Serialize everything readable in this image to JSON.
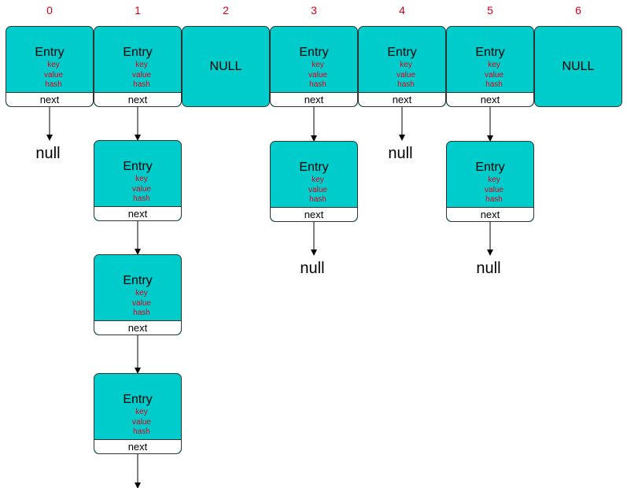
{
  "fill_color": "#00cccc",
  "index_color": "#d0021b",
  "entry_label": "Entry",
  "fields": [
    "key",
    "value",
    "hash"
  ],
  "next_label": "next",
  "null_slot_label": "NULL",
  "null_label": "null",
  "buckets": [
    {
      "index": "0",
      "slot": "entry",
      "chain_length": 0,
      "terminates_with": "null"
    },
    {
      "index": "1",
      "slot": "entry",
      "chain_length": 3,
      "terminates_with": "continues"
    },
    {
      "index": "2",
      "slot": "NULL"
    },
    {
      "index": "3",
      "slot": "entry",
      "chain_length": 1,
      "terminates_with": "null"
    },
    {
      "index": "4",
      "slot": "entry",
      "chain_length": 0,
      "terminates_with": "null"
    },
    {
      "index": "5",
      "slot": "entry",
      "chain_length": 1,
      "terminates_with": "null"
    },
    {
      "index": "6",
      "slot": "NULL"
    }
  ]
}
